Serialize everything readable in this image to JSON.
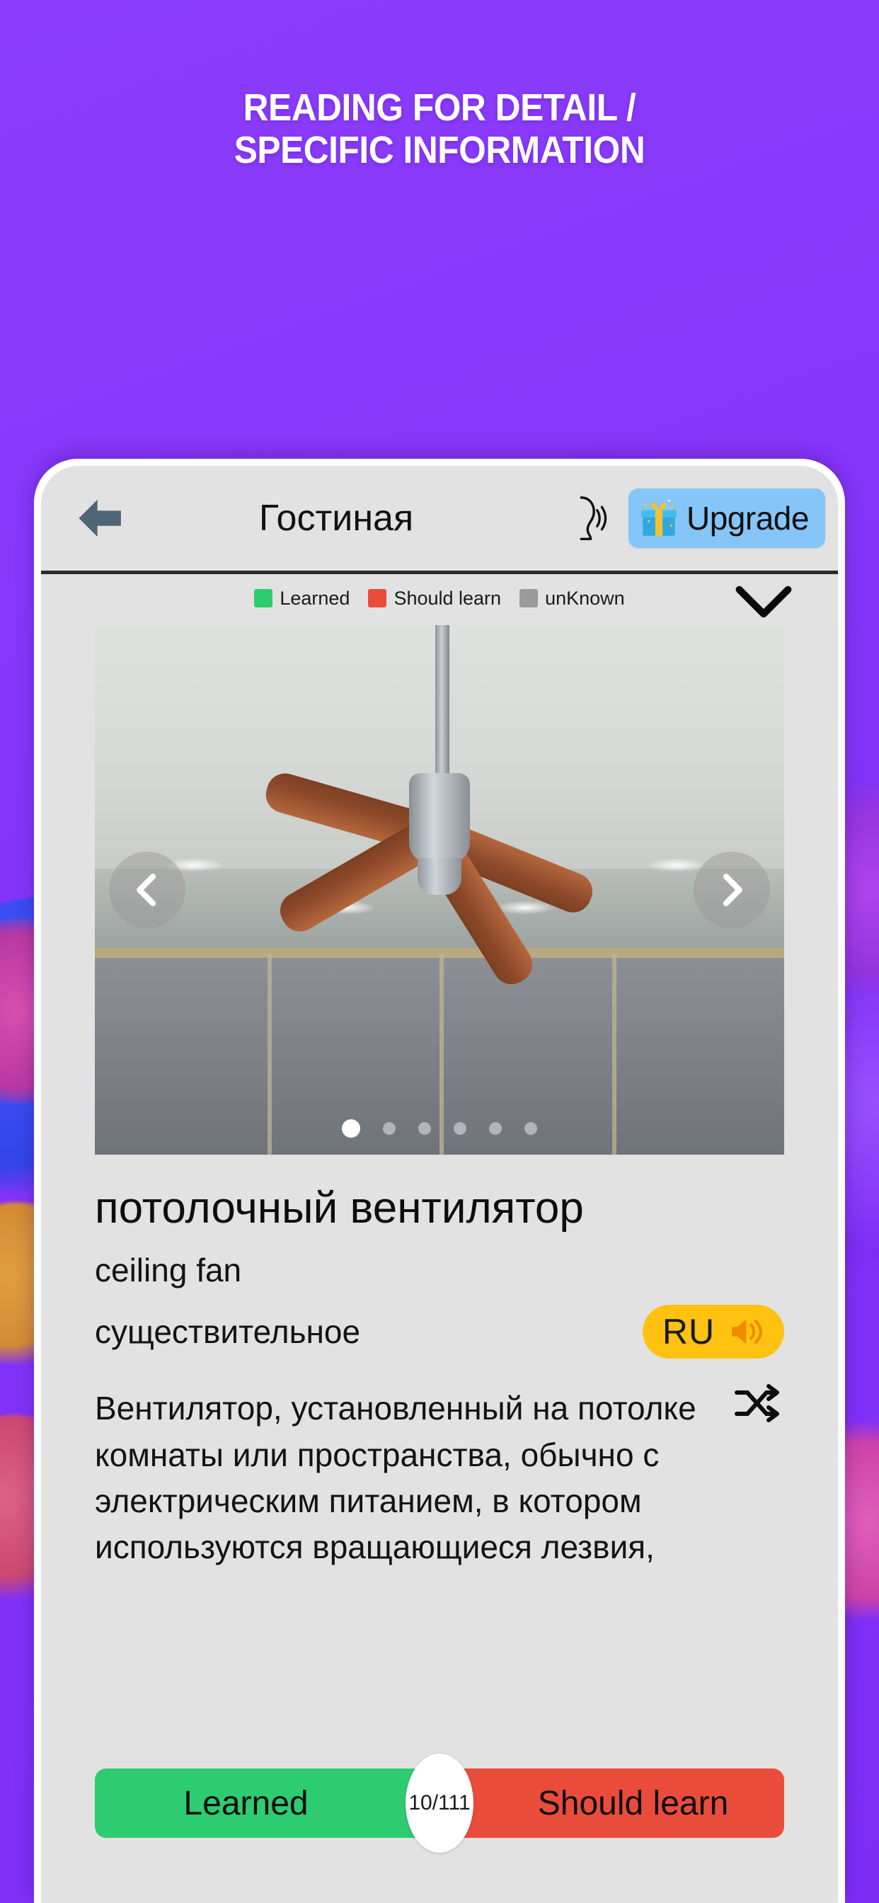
{
  "promo": {
    "title_line1": "READING FOR DETAIL /",
    "title_line2": "SPECIFIC INFORMATION",
    "background_color": "#8434F8",
    "title_color": "#FFFFFF"
  },
  "app": {
    "header": {
      "back_icon": "arrow-left-icon",
      "title": "Гостиная",
      "speak_icon": "speaking-head-icon",
      "upgrade": {
        "label": "Upgrade",
        "icon": "gift-icon",
        "background_color": "#86C5F7"
      }
    },
    "legend": {
      "items": [
        {
          "label": "Learned",
          "color": "#2ECC71"
        },
        {
          "label": "Should learn",
          "color": "#EA4C3C"
        },
        {
          "label": "unKnown",
          "color": "#9A9A9A"
        }
      ],
      "collapse_icon": "chevron-down-icon"
    },
    "carousel": {
      "prev_icon": "chevron-left-icon",
      "next_icon": "chevron-right-icon",
      "dot_count": 6,
      "active_dot": 1,
      "image_alt": "ceiling fan with wooden blades mounted on a ceiling"
    },
    "card": {
      "shuffle_icon": "shuffle-icon",
      "word": "потолочный вентилятор",
      "translation": "ceiling fan",
      "part_of_speech": "существительное",
      "speak": {
        "language_label": "RU",
        "icon": "speaker-icon",
        "background_color": "#FFC211"
      },
      "definition": "Вентилятор, установленный на потолке комнаты или пространства, обычно с электрическим питанием, в котором используются вращающиеся лезвия,"
    },
    "actions": {
      "learned_label": "Learned",
      "learned_color": "#2ECC71",
      "should_learn_label": "Should learn",
      "should_learn_color": "#EA4C3C",
      "progress": "10/111"
    }
  }
}
